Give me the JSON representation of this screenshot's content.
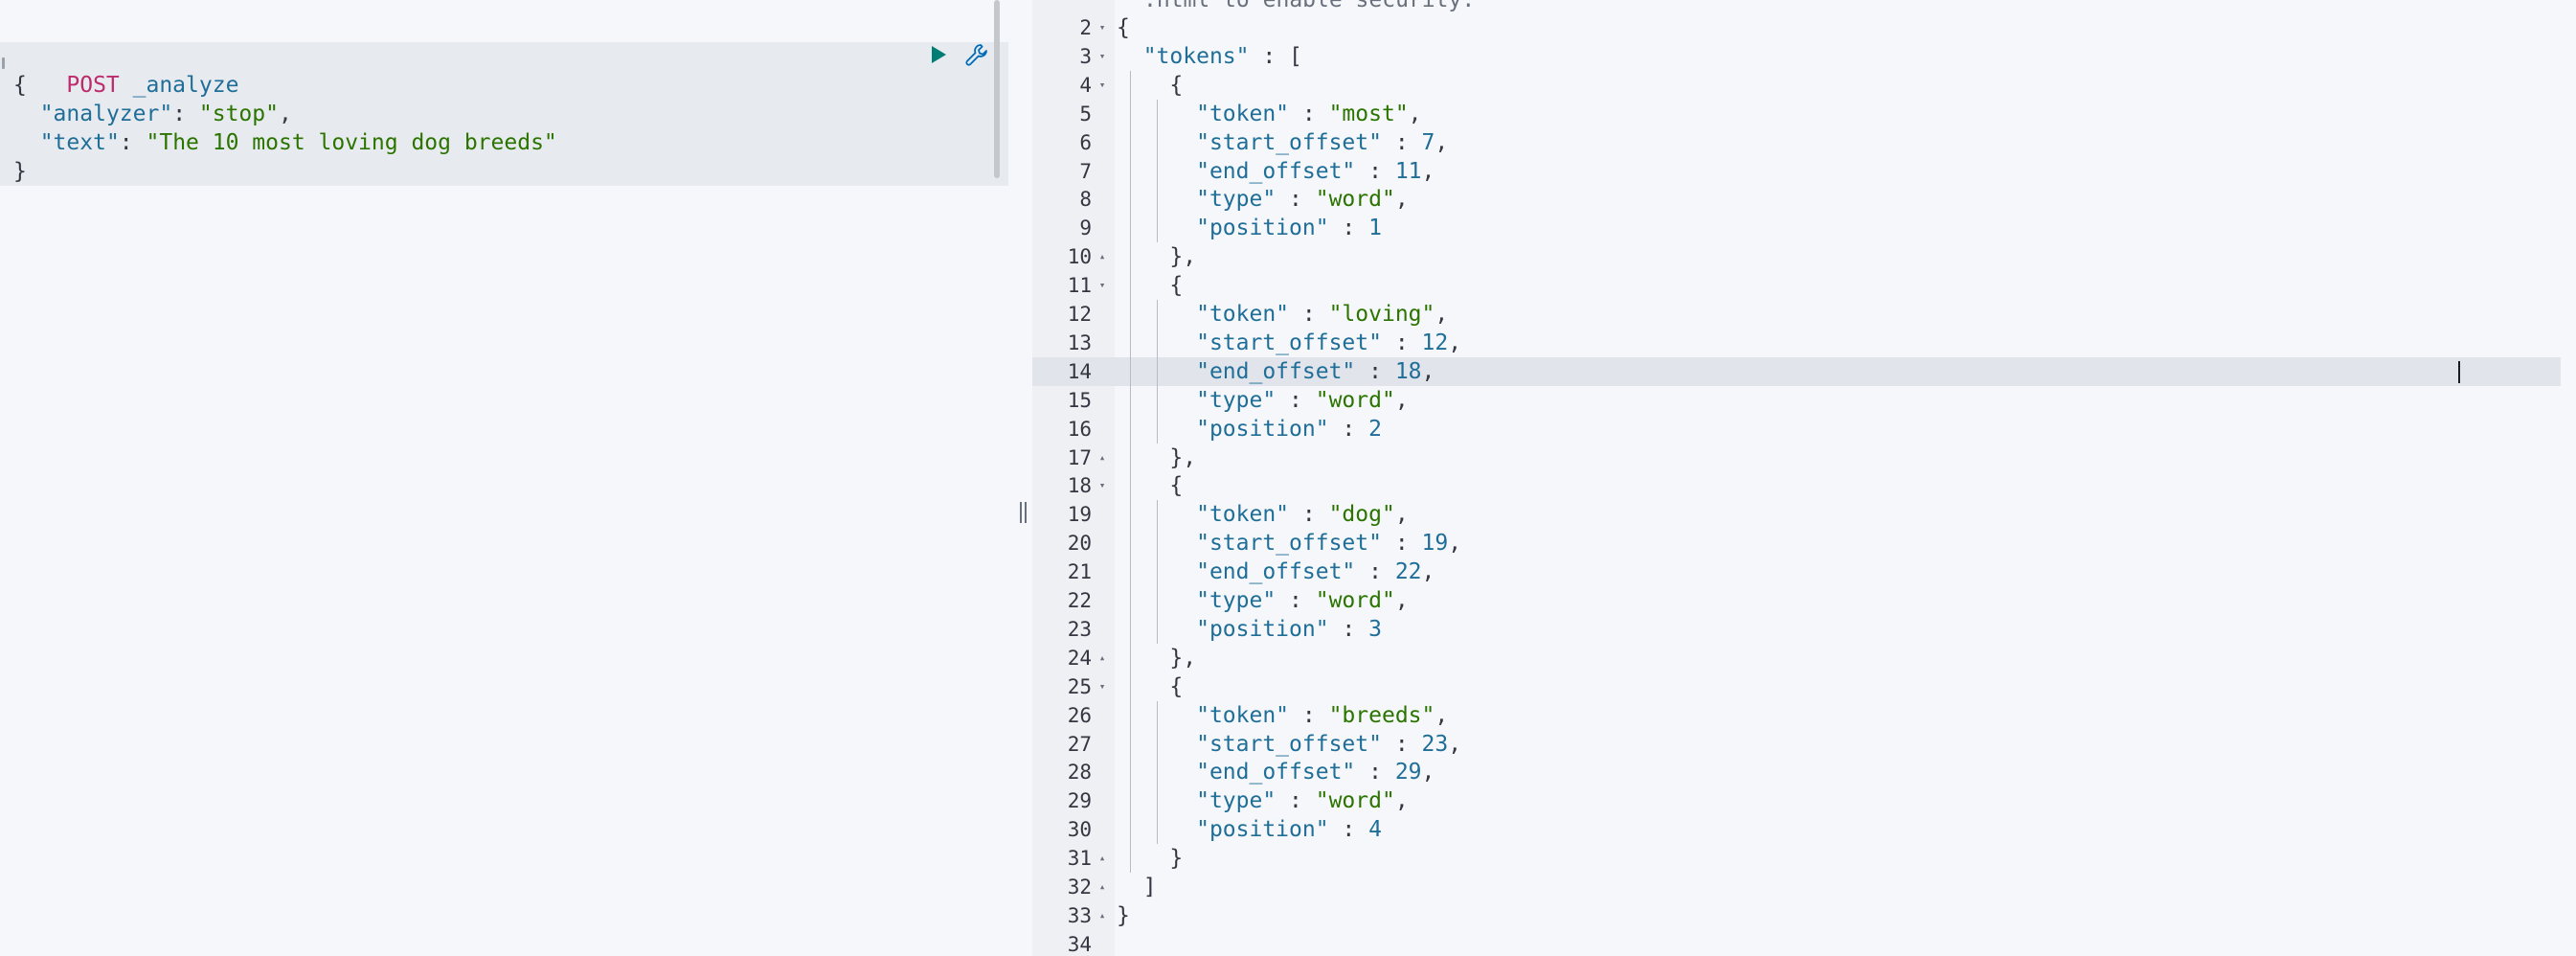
{
  "request": {
    "method": "POST",
    "path": "_analyze",
    "body_lines": [
      [
        {
          "t": "{",
          "c": "punct"
        }
      ],
      [
        {
          "t": "  ",
          "c": "punct"
        },
        {
          "t": "\"analyzer\"",
          "c": "key"
        },
        {
          "t": ": ",
          "c": "punct"
        },
        {
          "t": "\"stop\"",
          "c": "str"
        },
        {
          "t": ",",
          "c": "punct"
        }
      ],
      [
        {
          "t": "  ",
          "c": "punct"
        },
        {
          "t": "\"text\"",
          "c": "key"
        },
        {
          "t": ": ",
          "c": "punct"
        },
        {
          "t": "\"The 10 most loving dog breeds\"",
          "c": "str"
        }
      ],
      [
        {
          "t": "}",
          "c": "punct"
        }
      ]
    ]
  },
  "response": {
    "warning_text": ".html to enable security.",
    "active_line": 14,
    "lines": [
      {
        "n": "2",
        "fold": "down",
        "guides": 0,
        "tokens": [
          {
            "t": "{",
            "c": "punct"
          }
        ]
      },
      {
        "n": "3",
        "fold": "down",
        "guides": 0,
        "tokens": [
          {
            "t": "  ",
            "c": "punct"
          },
          {
            "t": "\"tokens\"",
            "c": "key"
          },
          {
            "t": " : [",
            "c": "punct"
          }
        ]
      },
      {
        "n": "4",
        "fold": "down",
        "guides": 1,
        "tokens": [
          {
            "t": "    {",
            "c": "punct"
          }
        ]
      },
      {
        "n": "5",
        "fold": "",
        "guides": 2,
        "tokens": [
          {
            "t": "      ",
            "c": "punct"
          },
          {
            "t": "\"token\"",
            "c": "key"
          },
          {
            "t": " : ",
            "c": "punct"
          },
          {
            "t": "\"most\"",
            "c": "str"
          },
          {
            "t": ",",
            "c": "punct"
          }
        ]
      },
      {
        "n": "6",
        "fold": "",
        "guides": 2,
        "tokens": [
          {
            "t": "      ",
            "c": "punct"
          },
          {
            "t": "\"start_offset\"",
            "c": "key"
          },
          {
            "t": " : ",
            "c": "punct"
          },
          {
            "t": "7",
            "c": "num"
          },
          {
            "t": ",",
            "c": "punct"
          }
        ]
      },
      {
        "n": "7",
        "fold": "",
        "guides": 2,
        "tokens": [
          {
            "t": "      ",
            "c": "punct"
          },
          {
            "t": "\"end_offset\"",
            "c": "key"
          },
          {
            "t": " : ",
            "c": "punct"
          },
          {
            "t": "11",
            "c": "num"
          },
          {
            "t": ",",
            "c": "punct"
          }
        ]
      },
      {
        "n": "8",
        "fold": "",
        "guides": 2,
        "tokens": [
          {
            "t": "      ",
            "c": "punct"
          },
          {
            "t": "\"type\"",
            "c": "key"
          },
          {
            "t": " : ",
            "c": "punct"
          },
          {
            "t": "\"word\"",
            "c": "str"
          },
          {
            "t": ",",
            "c": "punct"
          }
        ]
      },
      {
        "n": "9",
        "fold": "",
        "guides": 2,
        "tokens": [
          {
            "t": "      ",
            "c": "punct"
          },
          {
            "t": "\"position\"",
            "c": "key"
          },
          {
            "t": " : ",
            "c": "punct"
          },
          {
            "t": "1",
            "c": "num"
          }
        ]
      },
      {
        "n": "10",
        "fold": "up",
        "guides": 1,
        "tokens": [
          {
            "t": "    },",
            "c": "punct"
          }
        ]
      },
      {
        "n": "11",
        "fold": "down",
        "guides": 1,
        "tokens": [
          {
            "t": "    {",
            "c": "punct"
          }
        ]
      },
      {
        "n": "12",
        "fold": "",
        "guides": 2,
        "tokens": [
          {
            "t": "      ",
            "c": "punct"
          },
          {
            "t": "\"token\"",
            "c": "key"
          },
          {
            "t": " : ",
            "c": "punct"
          },
          {
            "t": "\"loving\"",
            "c": "str"
          },
          {
            "t": ",",
            "c": "punct"
          }
        ]
      },
      {
        "n": "13",
        "fold": "",
        "guides": 2,
        "tokens": [
          {
            "t": "      ",
            "c": "punct"
          },
          {
            "t": "\"start_offset\"",
            "c": "key"
          },
          {
            "t": " : ",
            "c": "punct"
          },
          {
            "t": "12",
            "c": "num"
          },
          {
            "t": ",",
            "c": "punct"
          }
        ]
      },
      {
        "n": "14",
        "fold": "",
        "guides": 2,
        "tokens": [
          {
            "t": "      ",
            "c": "punct"
          },
          {
            "t": "\"end_offset\"",
            "c": "key"
          },
          {
            "t": " : ",
            "c": "punct"
          },
          {
            "t": "18",
            "c": "num"
          },
          {
            "t": ",",
            "c": "punct"
          }
        ]
      },
      {
        "n": "15",
        "fold": "",
        "guides": 2,
        "tokens": [
          {
            "t": "      ",
            "c": "punct"
          },
          {
            "t": "\"type\"",
            "c": "key"
          },
          {
            "t": " : ",
            "c": "punct"
          },
          {
            "t": "\"word\"",
            "c": "str"
          },
          {
            "t": ",",
            "c": "punct"
          }
        ]
      },
      {
        "n": "16",
        "fold": "",
        "guides": 2,
        "tokens": [
          {
            "t": "      ",
            "c": "punct"
          },
          {
            "t": "\"position\"",
            "c": "key"
          },
          {
            "t": " : ",
            "c": "punct"
          },
          {
            "t": "2",
            "c": "num"
          }
        ]
      },
      {
        "n": "17",
        "fold": "up",
        "guides": 1,
        "tokens": [
          {
            "t": "    },",
            "c": "punct"
          }
        ]
      },
      {
        "n": "18",
        "fold": "down",
        "guides": 1,
        "tokens": [
          {
            "t": "    {",
            "c": "punct"
          }
        ]
      },
      {
        "n": "19",
        "fold": "",
        "guides": 2,
        "tokens": [
          {
            "t": "      ",
            "c": "punct"
          },
          {
            "t": "\"token\"",
            "c": "key"
          },
          {
            "t": " : ",
            "c": "punct"
          },
          {
            "t": "\"dog\"",
            "c": "str"
          },
          {
            "t": ",",
            "c": "punct"
          }
        ]
      },
      {
        "n": "20",
        "fold": "",
        "guides": 2,
        "tokens": [
          {
            "t": "      ",
            "c": "punct"
          },
          {
            "t": "\"start_offset\"",
            "c": "key"
          },
          {
            "t": " : ",
            "c": "punct"
          },
          {
            "t": "19",
            "c": "num"
          },
          {
            "t": ",",
            "c": "punct"
          }
        ]
      },
      {
        "n": "21",
        "fold": "",
        "guides": 2,
        "tokens": [
          {
            "t": "      ",
            "c": "punct"
          },
          {
            "t": "\"end_offset\"",
            "c": "key"
          },
          {
            "t": " : ",
            "c": "punct"
          },
          {
            "t": "22",
            "c": "num"
          },
          {
            "t": ",",
            "c": "punct"
          }
        ]
      },
      {
        "n": "22",
        "fold": "",
        "guides": 2,
        "tokens": [
          {
            "t": "      ",
            "c": "punct"
          },
          {
            "t": "\"type\"",
            "c": "key"
          },
          {
            "t": " : ",
            "c": "punct"
          },
          {
            "t": "\"word\"",
            "c": "str"
          },
          {
            "t": ",",
            "c": "punct"
          }
        ]
      },
      {
        "n": "23",
        "fold": "",
        "guides": 2,
        "tokens": [
          {
            "t": "      ",
            "c": "punct"
          },
          {
            "t": "\"position\"",
            "c": "key"
          },
          {
            "t": " : ",
            "c": "punct"
          },
          {
            "t": "3",
            "c": "num"
          }
        ]
      },
      {
        "n": "24",
        "fold": "up",
        "guides": 1,
        "tokens": [
          {
            "t": "    },",
            "c": "punct"
          }
        ]
      },
      {
        "n": "25",
        "fold": "down",
        "guides": 1,
        "tokens": [
          {
            "t": "    {",
            "c": "punct"
          }
        ]
      },
      {
        "n": "26",
        "fold": "",
        "guides": 2,
        "tokens": [
          {
            "t": "      ",
            "c": "punct"
          },
          {
            "t": "\"token\"",
            "c": "key"
          },
          {
            "t": " : ",
            "c": "punct"
          },
          {
            "t": "\"breeds\"",
            "c": "str"
          },
          {
            "t": ",",
            "c": "punct"
          }
        ]
      },
      {
        "n": "27",
        "fold": "",
        "guides": 2,
        "tokens": [
          {
            "t": "      ",
            "c": "punct"
          },
          {
            "t": "\"start_offset\"",
            "c": "key"
          },
          {
            "t": " : ",
            "c": "punct"
          },
          {
            "t": "23",
            "c": "num"
          },
          {
            "t": ",",
            "c": "punct"
          }
        ]
      },
      {
        "n": "28",
        "fold": "",
        "guides": 2,
        "tokens": [
          {
            "t": "      ",
            "c": "punct"
          },
          {
            "t": "\"end_offset\"",
            "c": "key"
          },
          {
            "t": " : ",
            "c": "punct"
          },
          {
            "t": "29",
            "c": "num"
          },
          {
            "t": ",",
            "c": "punct"
          }
        ]
      },
      {
        "n": "29",
        "fold": "",
        "guides": 2,
        "tokens": [
          {
            "t": "      ",
            "c": "punct"
          },
          {
            "t": "\"type\"",
            "c": "key"
          },
          {
            "t": " : ",
            "c": "punct"
          },
          {
            "t": "\"word\"",
            "c": "str"
          },
          {
            "t": ",",
            "c": "punct"
          }
        ]
      },
      {
        "n": "30",
        "fold": "",
        "guides": 2,
        "tokens": [
          {
            "t": "      ",
            "c": "punct"
          },
          {
            "t": "\"position\"",
            "c": "key"
          },
          {
            "t": " : ",
            "c": "punct"
          },
          {
            "t": "4",
            "c": "num"
          }
        ]
      },
      {
        "n": "31",
        "fold": "up",
        "guides": 1,
        "tokens": [
          {
            "t": "    }",
            "c": "punct"
          }
        ]
      },
      {
        "n": "32",
        "fold": "up",
        "guides": 0,
        "tokens": [
          {
            "t": "  ]",
            "c": "punct"
          }
        ]
      },
      {
        "n": "33",
        "fold": "up",
        "guides": 0,
        "tokens": [
          {
            "t": "}",
            "c": "punct"
          }
        ]
      },
      {
        "n": "34",
        "fold": "",
        "guides": 0,
        "tokens": []
      }
    ]
  },
  "icons": {
    "play": "play-icon",
    "settings": "wrench-icon",
    "fold_down": "caret-down-icon",
    "fold_up": "caret-up-icon"
  },
  "colors": {
    "method": "#bd2b6c",
    "key": "#1f6e98",
    "string": "#2b7400",
    "number": "#1f6e98",
    "play_button": "#017d73",
    "settings_icon": "#006bb8"
  }
}
